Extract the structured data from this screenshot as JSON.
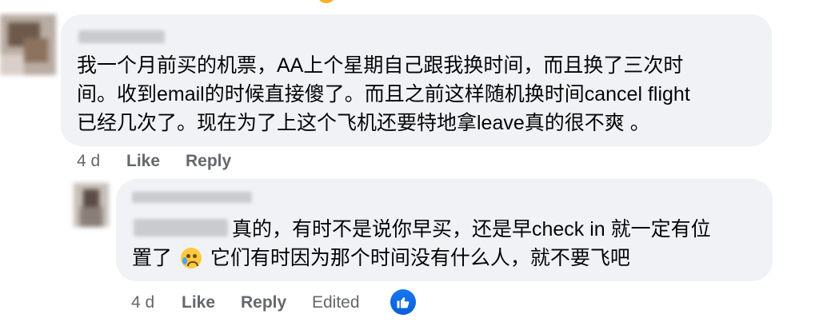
{
  "comment1": {
    "lines": [
      "我一个月前买的机票，AA上个星期自己跟我换时间，而且换了三次时",
      "间。收到email的时候直接傻了。而且之前这样随机换时间cancel flight",
      "已经几次了。现在为了上这个飞机还要特地拿leave真的很不爽 。"
    ],
    "time": "4 d",
    "like_label": "Like",
    "reply_label": "Reply"
  },
  "comment2": {
    "line1": "真的，有时不是说你早买，还是早check in 就一定有位",
    "line2_a": "置了",
    "line2_b": "它们有时因为那个时间没有什么人，就不要飞吧",
    "emoji": "crying-face-icon",
    "time": "4 d",
    "like_label": "Like",
    "reply_label": "Reply",
    "edited_label": "Edited",
    "reaction_icon": "thumbs-up-icon"
  },
  "colors": {
    "bubble": "#f0f2f5",
    "meta_text": "#65676b",
    "like_blue": "#1877f2"
  }
}
